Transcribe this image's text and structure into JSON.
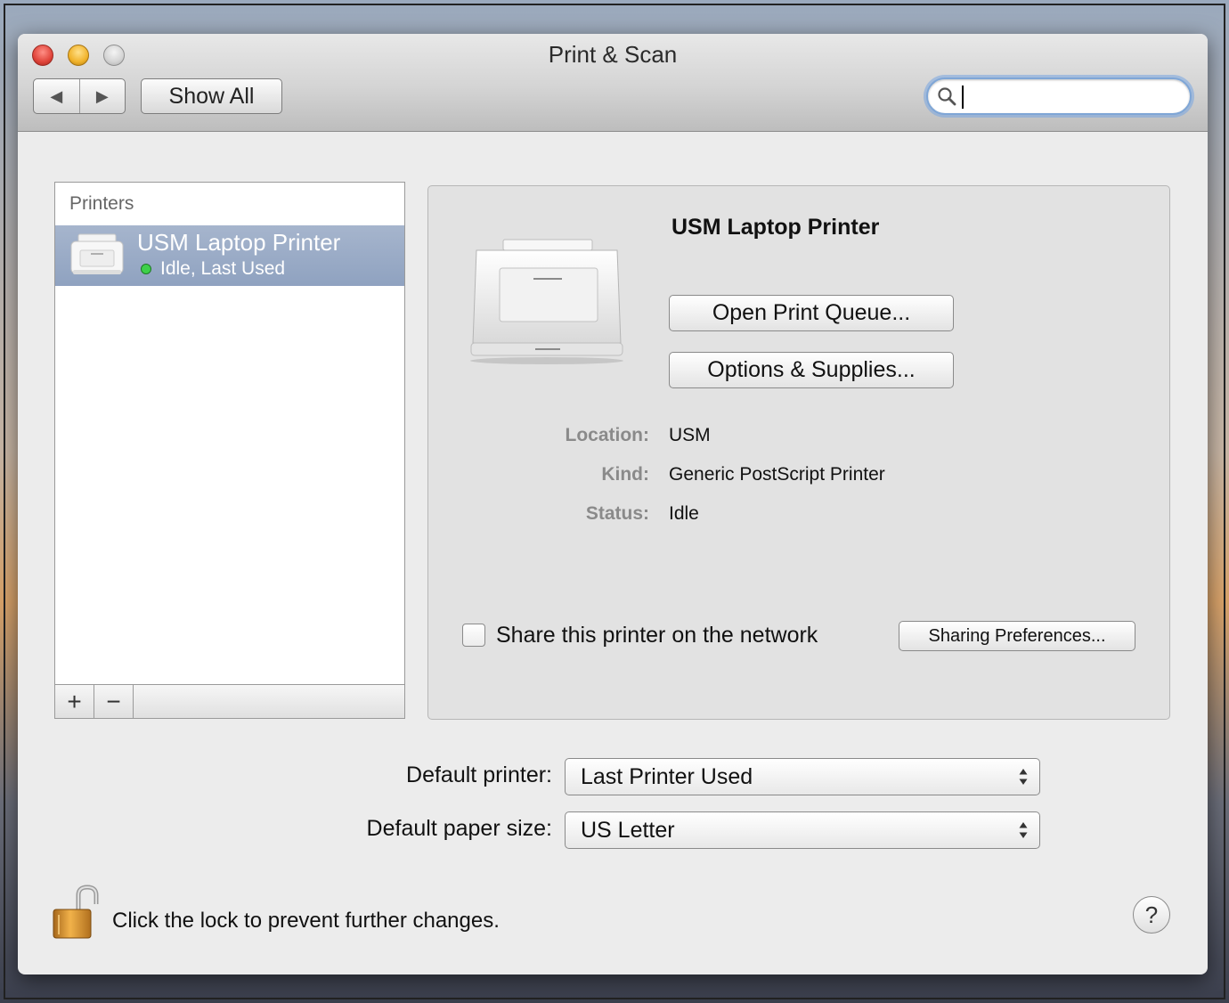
{
  "window": {
    "title": "Print & Scan",
    "show_all_label": "Show All",
    "nav_back_glyph": "◀",
    "nav_forward_glyph": "▶",
    "search": {
      "value": "",
      "placeholder": ""
    }
  },
  "printers_list": {
    "header": "Printers",
    "items": [
      {
        "name": "USM Laptop Printer",
        "status": "Idle, Last Used",
        "selected": true,
        "status_color": "#3ed04a"
      }
    ],
    "add_glyph": "+",
    "remove_glyph": "−"
  },
  "detail": {
    "printer_name": "USM Laptop Printer",
    "open_queue_label": "Open Print Queue...",
    "options_label": "Options & Supplies...",
    "info": {
      "location_label": "Location:",
      "location_value": "USM",
      "kind_label": "Kind:",
      "kind_value": "Generic PostScript Printer",
      "status_label": "Status:",
      "status_value": "Idle"
    },
    "share_label": "Share this printer on the network",
    "share_checked": false,
    "sharing_prefs_label": "Sharing Preferences..."
  },
  "defaults": {
    "printer_label": "Default printer:",
    "printer_value": "Last Printer Used",
    "paper_label": "Default paper size:",
    "paper_value": "US Letter"
  },
  "footer": {
    "lock_text": "Click the lock to prevent further changes.",
    "help_glyph": "?"
  },
  "icons": {
    "back": "back-arrow-icon",
    "forward": "forward-arrow-icon",
    "search": "search-icon",
    "printer": "printer-icon",
    "lock": "unlocked-padlock-icon",
    "help": "help-icon",
    "popup": "up-down-arrows-icon"
  },
  "colors": {
    "selection": "#8fa2c0",
    "status_idle": "#3ed04a",
    "focus_ring": "#7fa6d6"
  }
}
